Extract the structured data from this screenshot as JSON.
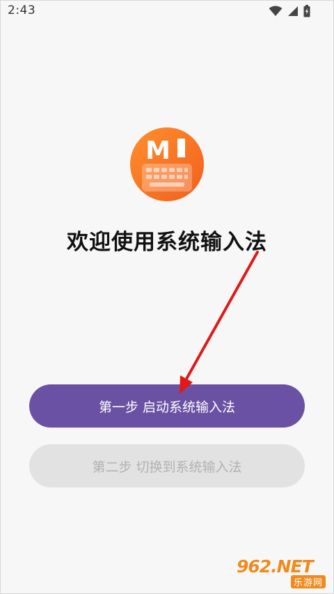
{
  "status_bar": {
    "time": "2:43",
    "icons": [
      "wifi-icon",
      "cellular-signal-icon",
      "battery-charging-icon"
    ]
  },
  "logo": {
    "letter": "M",
    "gradient": [
      "#ff8a2a",
      "#f26420"
    ],
    "icon": "keyboard-icon"
  },
  "welcome_title": "欢迎使用系统输入法",
  "buttons": {
    "step1": "第一步 启动系统输入法",
    "step2": "第二步 切换到系统输入法"
  },
  "colors": {
    "primary": "#6a51a3",
    "disabled_bg": "#e2e2e2",
    "disabled_text": "#b2b2b2",
    "arrow": "#e01919",
    "background": "#f7f7f7"
  },
  "watermark": {
    "main": "962.NET",
    "sub": "乐游网"
  }
}
